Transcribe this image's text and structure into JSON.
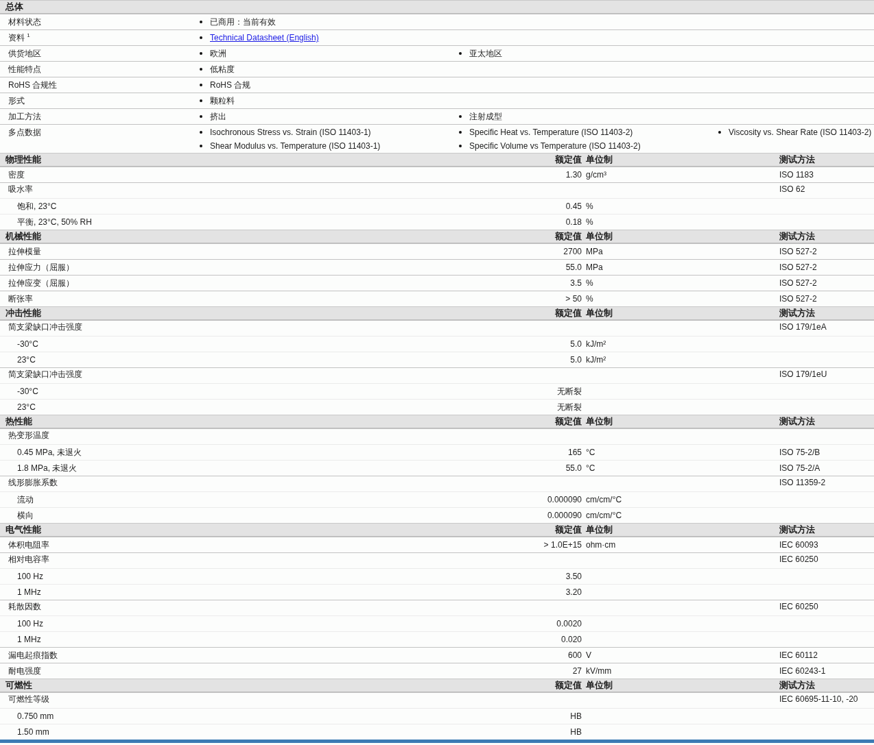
{
  "general": {
    "title": "总体",
    "rows": [
      {
        "label": "材料状态",
        "columns": [
          [
            {
              "text": "已商用：当前有效",
              "kind": "text"
            }
          ]
        ]
      },
      {
        "label": "资料 $^{1}$",
        "columns": [
          [
            {
              "text": "Technical Datasheet (English)",
              "kind": "link"
            }
          ]
        ]
      },
      {
        "label": "供货地区",
        "columns": [
          [
            {
              "text": "欧洲",
              "kind": "text"
            }
          ],
          [
            {
              "text": "亚太地区",
              "kind": "text"
            }
          ]
        ]
      },
      {
        "label": "性能特点",
        "columns": [
          [
            {
              "text": "低粘度",
              "kind": "text"
            }
          ]
        ]
      },
      {
        "label": "RoHS 合规性",
        "columns": [
          [
            {
              "text": "RoHS 合规",
              "kind": "text"
            }
          ]
        ]
      },
      {
        "label": "形式",
        "columns": [
          [
            {
              "text": "颗粒料",
              "kind": "text"
            }
          ]
        ]
      },
      {
        "label": "加工方法",
        "columns": [
          [
            {
              "text": "挤出",
              "kind": "text"
            }
          ],
          [
            {
              "text": "注射成型",
              "kind": "text"
            }
          ]
        ]
      },
      {
        "label": "多点数据",
        "columns": [
          [
            {
              "text": "Isochronous Stress vs. Strain (ISO 11403-1)",
              "kind": "text"
            },
            {
              "text": "Shear Modulus vs. Temperature (ISO 11403-1)",
              "kind": "text"
            }
          ],
          [
            {
              "text": "Specific Heat vs. Temperature (ISO 11403-2)",
              "kind": "text"
            },
            {
              "text": "Specific Volume vs Temperature (ISO 11403-2)",
              "kind": "text"
            }
          ],
          [
            {
              "text": "Viscosity vs. Shear Rate (ISO 11403-2)",
              "kind": "text"
            }
          ]
        ]
      }
    ]
  },
  "sections": [
    {
      "title": "物理性能",
      "value_header": "额定值",
      "unit_header": "单位制",
      "method_header": "测试方法",
      "rows": [
        {
          "label": "密度",
          "value": "1.30",
          "unit": "g/cm³",
          "method": "ISO 1183"
        },
        {
          "label": "吸水率",
          "method": "ISO 62",
          "children": [
            {
              "label": "饱和, 23°C",
              "value": "0.45",
              "unit": "%"
            },
            {
              "label": "平衡, 23°C, 50% RH",
              "value": "0.18",
              "unit": "%"
            }
          ]
        }
      ]
    },
    {
      "title": "机械性能",
      "value_header": "额定值",
      "unit_header": "单位制",
      "method_header": "测试方法",
      "rows": [
        {
          "label": "拉伸模量",
          "value": "2700",
          "unit": "MPa",
          "method": "ISO 527-2"
        },
        {
          "label": "拉伸应力（屈服）",
          "value": "55.0",
          "unit": "MPa",
          "method": "ISO 527-2"
        },
        {
          "label": "拉伸应变（屈服）",
          "value": "3.5",
          "unit": "%",
          "method": "ISO 527-2"
        },
        {
          "label": "断张率",
          "value": "> 50",
          "unit": "%",
          "method": "ISO 527-2"
        }
      ]
    },
    {
      "title": "冲击性能",
      "value_header": "额定值",
      "unit_header": "单位制",
      "method_header": "测试方法",
      "rows": [
        {
          "label": "简支梁缺口冲击强度",
          "method": "ISO 179/1eA",
          "children": [
            {
              "label": "-30°C",
              "value": "5.0",
              "unit": "kJ/m²"
            },
            {
              "label": "23°C",
              "value": "5.0",
              "unit": "kJ/m²"
            }
          ]
        },
        {
          "label": "简支梁缺口冲击强度",
          "method": "ISO 179/1eU",
          "children": [
            {
              "label": "-30°C",
              "value": "无断裂"
            },
            {
              "label": "23°C",
              "value": "无断裂"
            }
          ]
        }
      ]
    },
    {
      "title": "热性能",
      "value_header": "额定值",
      "unit_header": "单位制",
      "method_header": "测试方法",
      "rows": [
        {
          "label": "热变形温度",
          "children": [
            {
              "label": "0.45 MPa, 未退火",
              "value": "165",
              "unit": "°C",
              "method": "ISO 75-2/B"
            },
            {
              "label": "1.8 MPa, 未退火",
              "value": "55.0",
              "unit": "°C",
              "method": "ISO 75-2/A"
            }
          ]
        },
        {
          "label": "线形膨胀系数",
          "method": "ISO 11359-2",
          "children": [
            {
              "label": "流动",
              "value": "0.000090",
              "unit": "cm/cm/°C"
            },
            {
              "label": "横向",
              "value": "0.000090",
              "unit": "cm/cm/°C"
            }
          ]
        }
      ]
    },
    {
      "title": "电气性能",
      "value_header": "额定值",
      "unit_header": "单位制",
      "method_header": "测试方法",
      "rows": [
        {
          "label": "体积电阻率",
          "value": "> 1.0E+15",
          "unit": "ohm·cm",
          "method": "IEC 60093"
        },
        {
          "label": "相对电容率",
          "method": "IEC 60250",
          "children": [
            {
              "label": "100 Hz",
              "value": "3.50"
            },
            {
              "label": "1 MHz",
              "value": "3.20"
            }
          ]
        },
        {
          "label": "耗散因数",
          "method": "IEC 60250",
          "children": [
            {
              "label": "100 Hz",
              "value": "0.0020"
            },
            {
              "label": "1 MHz",
              "value": "0.020"
            }
          ]
        },
        {
          "label": "漏电起痕指数",
          "value": "600",
          "unit": "V",
          "method": "IEC 60112"
        },
        {
          "label": "耐电强度",
          "value": "27",
          "unit": "kV/mm",
          "method": "IEC 60243-1"
        }
      ]
    },
    {
      "title": "可燃性",
      "value_header": "额定值",
      "unit_header": "单位制",
      "method_header": "测试方法",
      "rows": [
        {
          "label": "可燃性等级",
          "method": "IEC 60695-11-10, -20",
          "children": [
            {
              "label": "0.750 mm",
              "value": "HB"
            },
            {
              "label": "1.50 mm",
              "value": "HB"
            }
          ]
        }
      ]
    }
  ]
}
